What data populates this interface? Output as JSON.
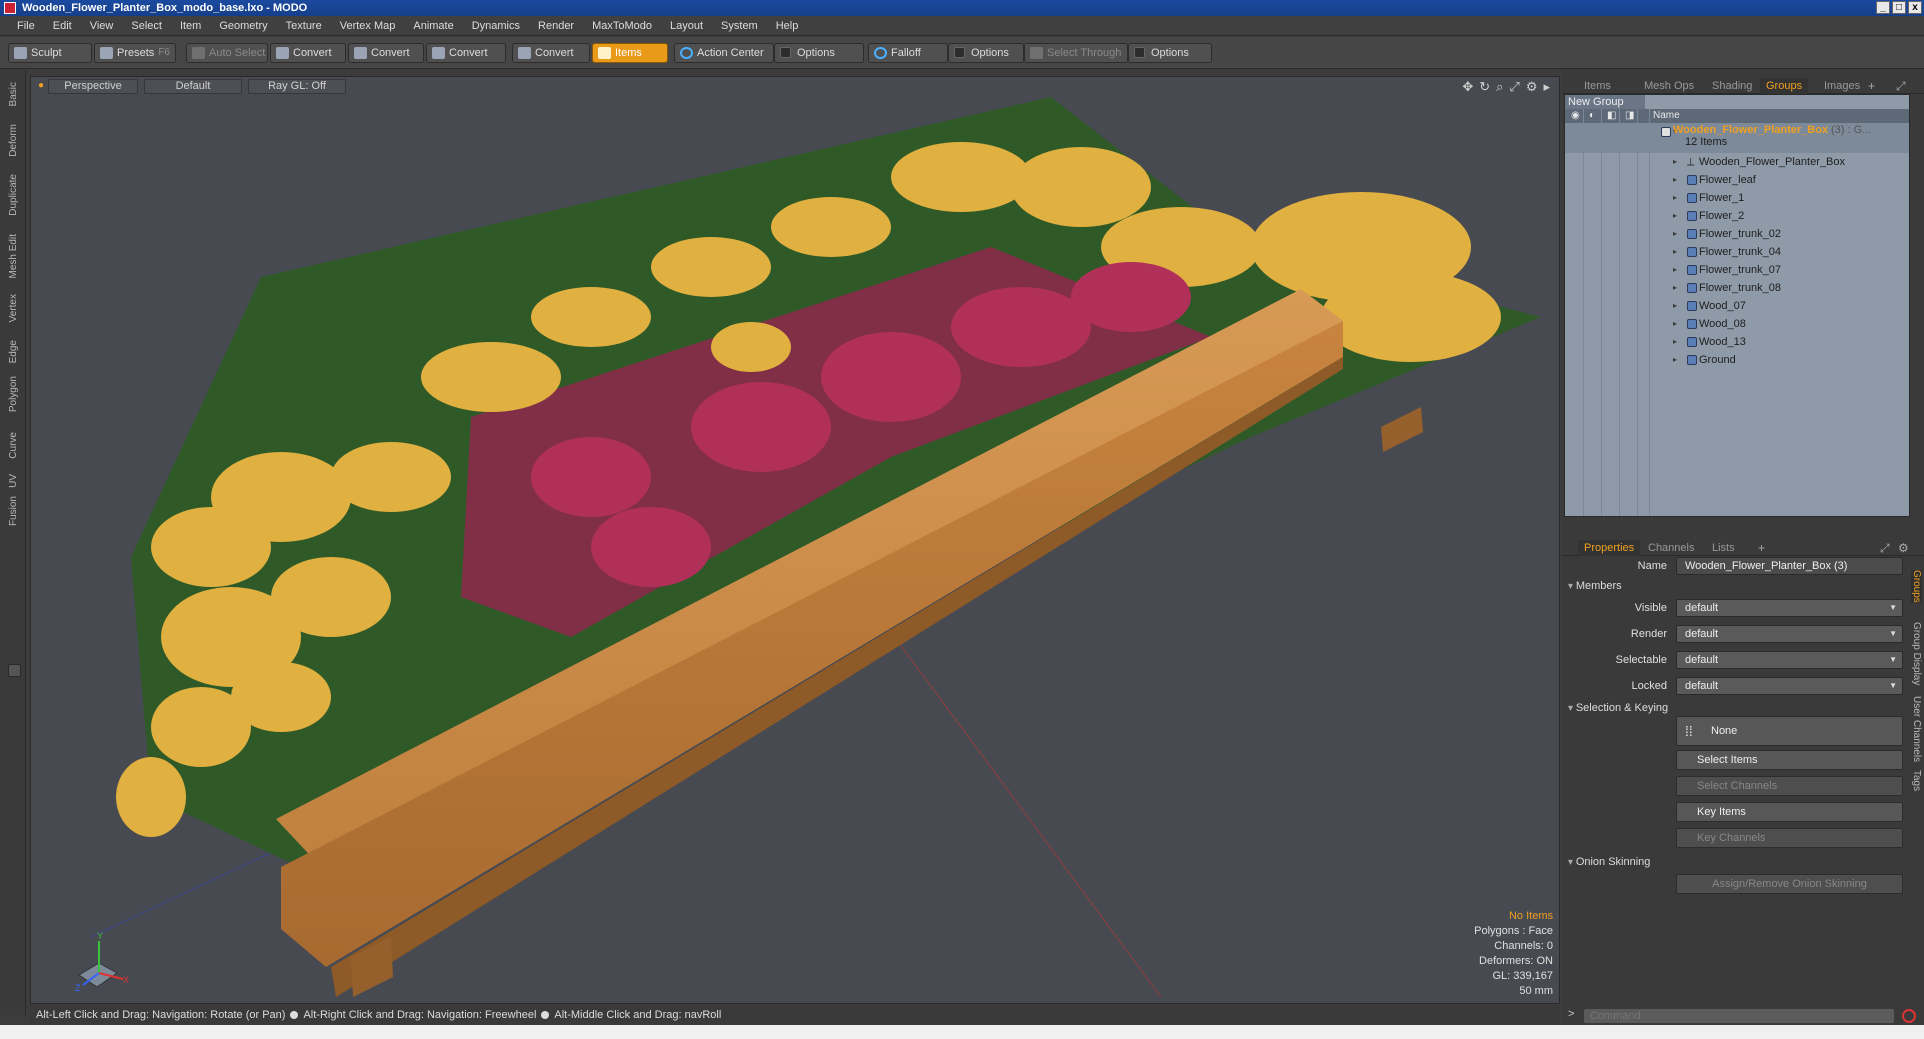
{
  "window": {
    "title": "Wooden_Flower_Planter_Box_modo_base.lxo - MODO",
    "controls": [
      "_",
      "□",
      "x"
    ]
  },
  "menu": [
    "File",
    "Edit",
    "View",
    "Select",
    "Item",
    "Geometry",
    "Texture",
    "Vertex Map",
    "Animate",
    "Dynamics",
    "Render",
    "MaxToModo",
    "Layout",
    "System",
    "Help"
  ],
  "toolbar": {
    "sculpt": "Sculpt",
    "presets": "Presets",
    "presets_key": "F6",
    "auto_select": "Auto Select",
    "convert1": "Convert",
    "convert2": "Convert",
    "convert3": "Convert",
    "convert4": "Convert",
    "items": "Items",
    "action_center": "Action Center",
    "options1": "Options",
    "falloff": "Falloff",
    "options2": "Options",
    "select_through": "Select Through",
    "options3": "Options"
  },
  "left_tabs": [
    "Basic",
    "Deform",
    "Duplicate",
    "Mesh Edit",
    "Vertex",
    "Edge",
    "Polygon",
    "Curve",
    "UV",
    "Fusion"
  ],
  "viewport": {
    "view_mode": "Perspective",
    "shading": "Default",
    "raygl": "Ray GL: Off",
    "hud": {
      "selection": "No Items",
      "polygons": "Polygons : Face",
      "channels": "Channels: 0",
      "deformers": "Deformers: ON",
      "gl": "GL: 339,167",
      "unit": "50 mm"
    },
    "axis": {
      "x": "X",
      "y": "Y",
      "z": "Z"
    }
  },
  "status_bar": {
    "hint1": "Alt-Left Click and Drag: Navigation: Rotate (or Pan)",
    "hint2": "Alt-Right Click and Drag: Navigation: Freewheel",
    "hint3": "Alt-Middle Click and Drag: navRoll"
  },
  "top_tabs": {
    "items": "Items",
    "mesh_ops": "Mesh Ops",
    "shading": "Shading",
    "groups": "Groups",
    "images": "Images",
    "plus": "+"
  },
  "groups": {
    "new_group": "New Group",
    "name_col": "Name",
    "root": {
      "label": "Wooden_Flower_Planter_Box",
      "suffix": "(3) : G...",
      "count": "12 Items"
    },
    "items": [
      "Wooden_Flower_Planter_Box",
      "Flower_leaf",
      "Flower_1",
      "Flower_2",
      "Flower_trunk_02",
      "Flower_trunk_04",
      "Flower_trunk_07",
      "Flower_trunk_08",
      "Wood_07",
      "Wood_08",
      "Wood_13",
      "Ground"
    ]
  },
  "prop_tabs": {
    "properties": "Properties",
    "channels": "Channels",
    "lists": "Lists",
    "plus": "+"
  },
  "properties": {
    "name_label": "Name",
    "name_value": "Wooden_Flower_Planter_Box (3)",
    "members": "Members",
    "visible_label": "Visible",
    "visible_value": "default",
    "render_label": "Render",
    "render_value": "default",
    "selectable_label": "Selectable",
    "selectable_value": "default",
    "locked_label": "Locked",
    "locked_value": "default",
    "selection_keying": "Selection & Keying",
    "none": "None",
    "select_items": "Select Items",
    "select_channels": "Select Channels",
    "key_items": "Key Items",
    "key_channels": "Key Channels",
    "onion_skinning": "Onion Skinning",
    "assign_onion": "Assign/Remove Onion Skinning"
  },
  "side_tabs": [
    "Groups",
    "Group Display",
    "User Channels",
    "Tags"
  ],
  "command": {
    "prompt": ">",
    "placeholder": "Command"
  },
  "colors": {
    "accent": "#f0a020",
    "title_bg": "#1a4aa0",
    "viewport_bg": "#474a51",
    "list_bg": "#8e9aa8"
  }
}
